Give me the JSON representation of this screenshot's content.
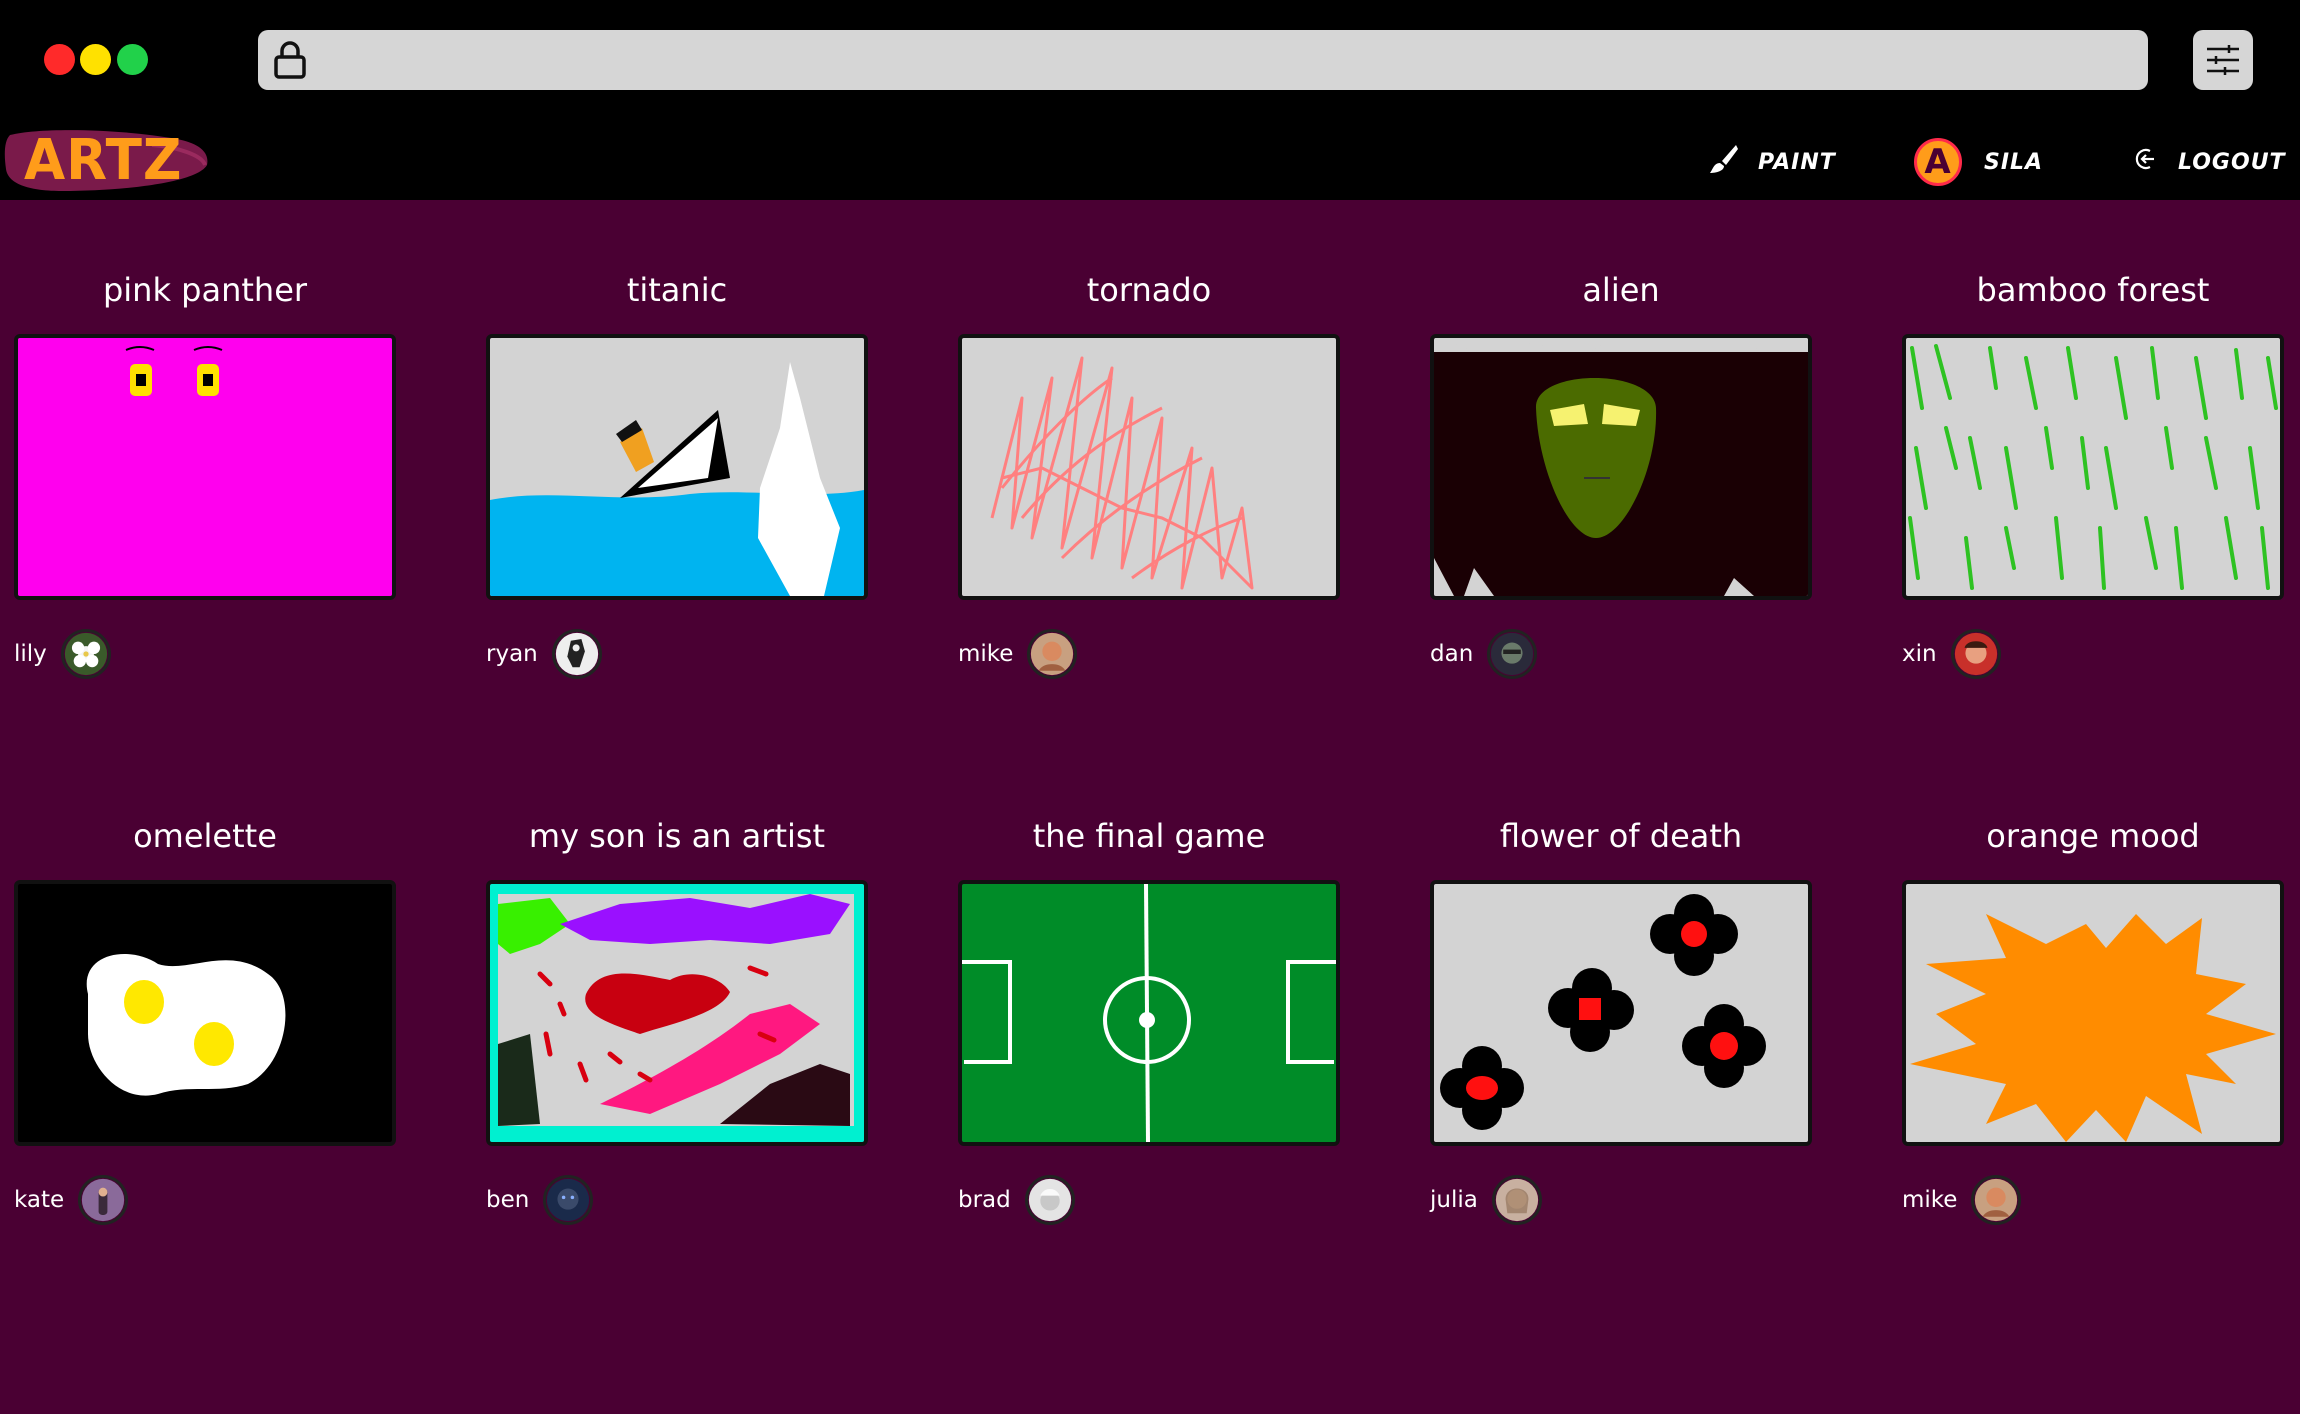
{
  "app": {
    "name": "ARTZ"
  },
  "nav": {
    "paint_label": "PAINT",
    "user_initial": "A",
    "user_name": "SILA",
    "logout_label": "LOGOUT"
  },
  "colors": {
    "background": "#4a0033",
    "accent": "#ff9c1a",
    "chrome": "#000000"
  },
  "gallery": [
    {
      "title": "pink panther",
      "author": "lily",
      "art": "pink-panther"
    },
    {
      "title": "titanic",
      "author": "ryan",
      "art": "titanic"
    },
    {
      "title": "tornado",
      "author": "mike",
      "art": "tornado"
    },
    {
      "title": "alien",
      "author": "dan",
      "art": "alien"
    },
    {
      "title": "bamboo forest",
      "author": "xin",
      "art": "bamboo-forest"
    },
    {
      "title": "omelette",
      "author": "kate",
      "art": "omelette"
    },
    {
      "title": "my son is an artist",
      "author": "ben",
      "art": "abstract"
    },
    {
      "title": "the final game",
      "author": "brad",
      "art": "football-pitch"
    },
    {
      "title": "flower of death",
      "author": "julia",
      "art": "flowers"
    },
    {
      "title": "orange mood",
      "author": "mike",
      "art": "orange-burst"
    }
  ],
  "icons": {
    "lock": "lock-icon",
    "settings": "sliders-icon",
    "paint": "brush-icon",
    "logout": "logout-icon"
  }
}
